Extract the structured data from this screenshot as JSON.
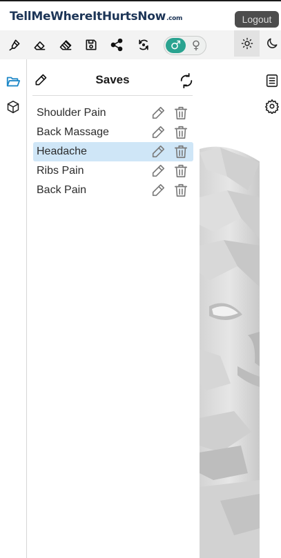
{
  "app": {
    "logo_main": "TellMeWhereItHurtsNow",
    "logo_suffix": ".com",
    "logout_label": "Logout"
  },
  "toolbar": {
    "tools": [
      {
        "name": "pen-icon"
      },
      {
        "name": "eraser-icon"
      },
      {
        "name": "clear-eraser-icon"
      },
      {
        "name": "save-icon"
      },
      {
        "name": "share-icon"
      },
      {
        "name": "rotate-icon"
      }
    ],
    "gender": {
      "male_symbol": "♂",
      "female_symbol": "♀",
      "selected": "male"
    },
    "theme": {
      "light_symbol": "☼",
      "selected": "light"
    }
  },
  "colors": {
    "accent": "#2aa390",
    "selected_row": "#cfe6f7",
    "logo": "#1d3557",
    "logout_bg": "#4d4d4d"
  },
  "panel": {
    "title": "Saves",
    "items": [
      {
        "label": "Shoulder Pain",
        "selected": false
      },
      {
        "label": "Back Massage",
        "selected": false
      },
      {
        "label": "Headache",
        "selected": true
      },
      {
        "label": "Ribs Pain",
        "selected": false
      },
      {
        "label": "Back Pain",
        "selected": false
      }
    ]
  }
}
